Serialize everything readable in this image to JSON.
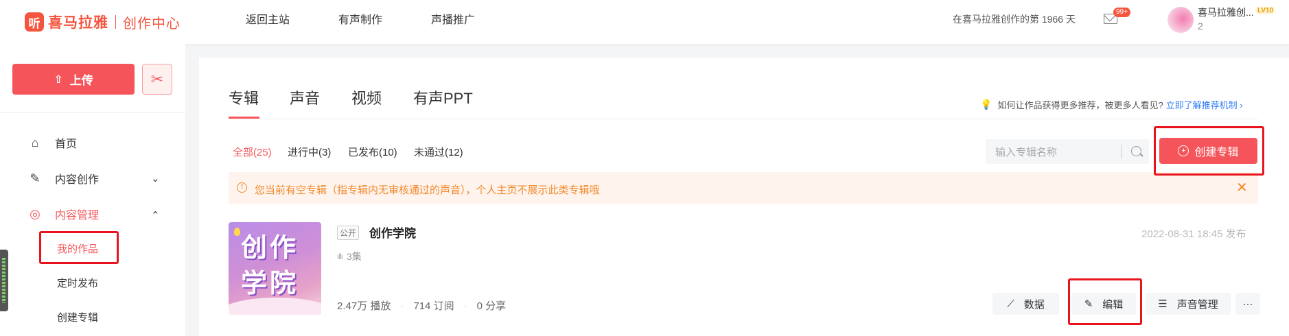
{
  "header": {
    "logo_mark": "听",
    "logo_text": "喜马拉雅",
    "logo_sub": "创作中心",
    "nav": [
      "返回主站",
      "有声制作",
      "声播推广"
    ],
    "days_text": "在喜马拉雅创作的第 1966 天",
    "mail_badge": "99+",
    "user_name": "喜马拉雅创...",
    "user_count": "2",
    "level": "LV10"
  },
  "sidebar": {
    "upload_label": "上传",
    "items": [
      {
        "label": "首页",
        "icon": "home-icon"
      },
      {
        "label": "内容创作",
        "icon": "pen-icon"
      },
      {
        "label": "内容管理",
        "icon": "manage-icon"
      }
    ],
    "sub_items": [
      "我的作品",
      "定时发布",
      "创建专辑"
    ]
  },
  "main": {
    "tabs": [
      "专辑",
      "声音",
      "视频",
      "有声PPT"
    ],
    "tip_text": "如何让作品获得更多推荐，被更多人看见?",
    "tip_link": "立即了解推荐机制 ›",
    "filters": [
      "全部(25)",
      "进行中(3)",
      "已发布(10)",
      "未通过(12)"
    ],
    "search_placeholder": "输入专辑名称",
    "create_label": "创建专辑",
    "notice": "您当前有空专辑（指专辑内无审核通过的声音），个人主页不展示此类专辑哦",
    "album": {
      "cover_text_1": "创作",
      "cover_text_2": "学院",
      "public_badge": "公开",
      "title": "创作学院",
      "episodes": "3集",
      "date": "2022-08-31 18:45 发布",
      "plays": "2.47万 播放",
      "subs": "714 订阅",
      "shares": "0 分享",
      "actions": [
        "数据",
        "编辑",
        "声音管理",
        "···"
      ]
    }
  },
  "colors": {
    "accent": "#f5555a",
    "highlight_box": "#e8141c",
    "link": "#2f7cf6",
    "warning": "#f0892c"
  }
}
